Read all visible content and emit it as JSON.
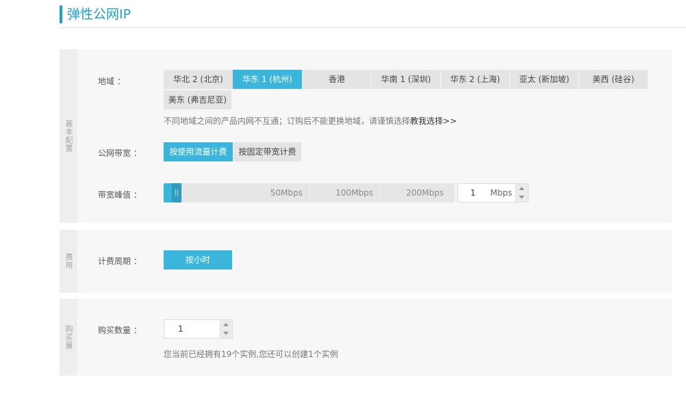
{
  "page": {
    "title": "弹性公网IP"
  },
  "sections": {
    "basic": {
      "side_label": "基本配置"
    },
    "fee": {
      "side_label": "费用"
    },
    "purchase": {
      "side_label": "购买量"
    }
  },
  "region": {
    "label": "地域 ：",
    "options": [
      "华北 2 (北京)",
      "华东 1 (杭州)",
      "香港",
      "华南 1 (深圳)",
      "华东 2 (上海)",
      "亚太 (新加坡)",
      "美西 (硅谷)",
      "美东 (弗吉尼亚)"
    ],
    "selected": "华东 1 (杭州)",
    "hint_text": "不同地域之间的产品内网不互通；订购后不能更换地域，请谨慎选择",
    "hint_link": "教我选择>>"
  },
  "bandwidth_billing": {
    "label": "公网带宽 ：",
    "options": [
      "按使用流量计费",
      "按固定带宽计费"
    ],
    "selected": "按使用流量计费"
  },
  "bandwidth_peak": {
    "label": "带宽峰值 ：",
    "marks": [
      "50Mbps",
      "100Mbps",
      "200Mbps"
    ],
    "value": "1",
    "unit": "Mbps",
    "slider_fraction": 0.005
  },
  "billing_cycle": {
    "label": "计费周期 ：",
    "options": [
      "按小时"
    ],
    "selected": "按小时"
  },
  "quantity": {
    "label": "购买数量 ：",
    "value": "1",
    "hint": "您当前已经拥有19个实例,您还可以创建1个实例"
  },
  "colors": {
    "accent": "#3bb5dc",
    "title": "#1da1c7",
    "section_bg": "#f7f7f7"
  }
}
